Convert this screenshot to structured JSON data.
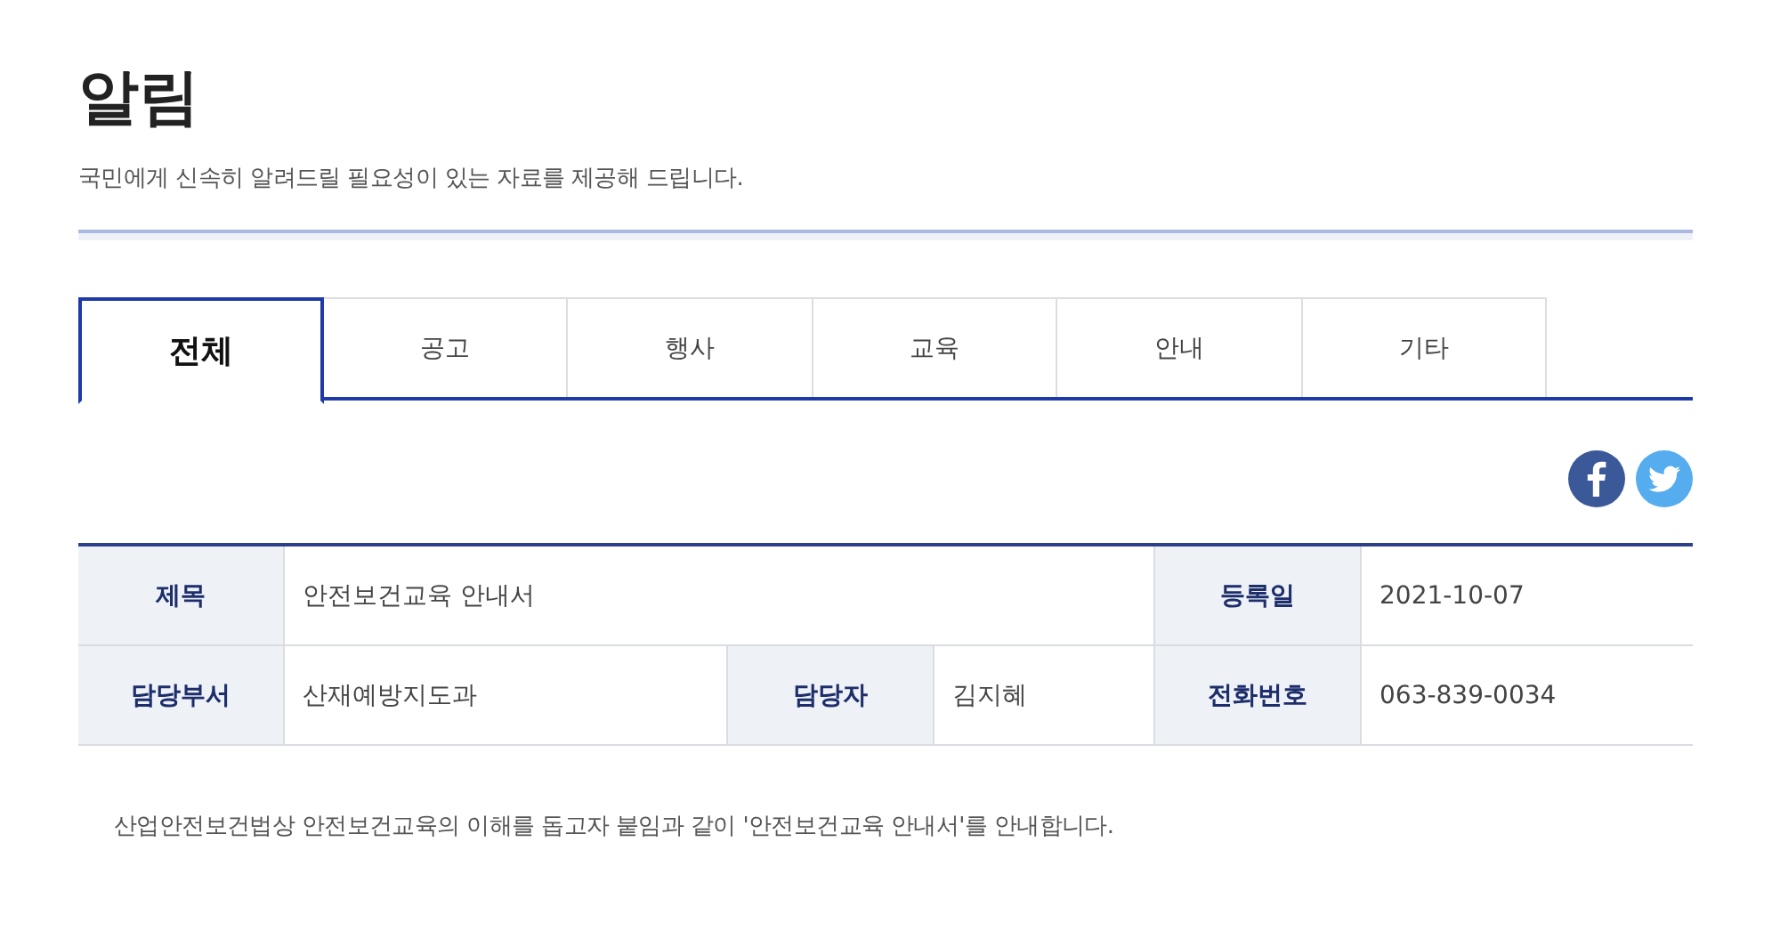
{
  "page": {
    "title": "알림",
    "description": "국민에게 신속히 알려드릴 필요성이 있는 자료를 제공해 드립니다."
  },
  "tabs": [
    {
      "label": "전체",
      "selected": true
    },
    {
      "label": "공고",
      "selected": false
    },
    {
      "label": "행사",
      "selected": false
    },
    {
      "label": "교육",
      "selected": false
    },
    {
      "label": "안내",
      "selected": false
    },
    {
      "label": "기타",
      "selected": false
    }
  ],
  "share": [
    {
      "kind": "facebook"
    },
    {
      "kind": "twitter"
    }
  ],
  "fields": [
    {
      "label": "제목",
      "value": "안전보건교육 안내서",
      "wide": true
    },
    {
      "label": "등록일",
      "value": "2021-10-07",
      "wide": false
    },
    {
      "label": "담당부서",
      "value": "산재예방지도과",
      "wide": false
    },
    {
      "label": "담당자",
      "value": "김지혜",
      "wide": false
    },
    {
      "label": "전화번호",
      "value": "063-839-0034",
      "wide": false
    }
  ],
  "body": "산업안전보건법상 안전보건교육의 이해를 돕고자 붙임과 같이 '안전보건교육 안내서'를 안내합니다."
}
